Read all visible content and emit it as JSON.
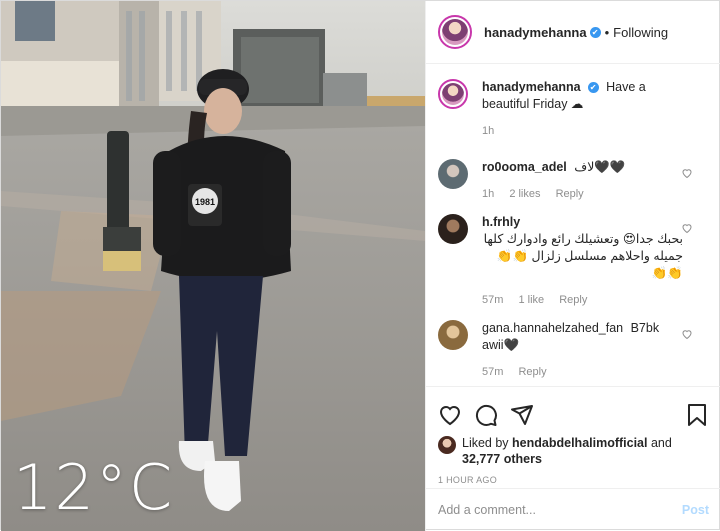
{
  "photo": {
    "temperature": "12°C",
    "cup_text": "1981"
  },
  "header": {
    "username": "hanadymehanna",
    "verified_mark": "✔",
    "separator": "•",
    "follow_status": "Following"
  },
  "caption": {
    "username": "hanadymehanna",
    "text": "Have a beautiful Friday ☁",
    "time": "1h"
  },
  "comments": [
    {
      "username": "ro0ooma_adel",
      "text": "لاف🖤🖤",
      "time": "1h",
      "likes": "2 likes",
      "reply": "Reply"
    },
    {
      "username": "h.frhly",
      "text": "بحبك جدا😍 وتعشيلك رائع وادوارك كلها جميله واحلاهم مسلسل زلزال 👏👏👏👏",
      "time": "57m",
      "likes": "1 like",
      "reply": "Reply"
    },
    {
      "username": "gana.hannahelzahed_fan",
      "text": "B7bk awii🖤",
      "time": "57m",
      "likes": "",
      "reply": "Reply"
    }
  ],
  "actions": {
    "like_icon": "heart-icon",
    "comment_icon": "comment-icon",
    "share_icon": "share-icon",
    "save_icon": "bookmark-icon"
  },
  "likes": {
    "prefix": "Liked by",
    "user": "hendabdelhalimofficial",
    "and": "and",
    "others": "32,777 others"
  },
  "timestamp": "1 HOUR AGO",
  "add_comment": {
    "placeholder": "Add a comment...",
    "post_label": "Post"
  },
  "colors": {
    "verified": "#3897f0",
    "post_disabled": "#b3dbff",
    "muted": "#8e8e8e"
  }
}
